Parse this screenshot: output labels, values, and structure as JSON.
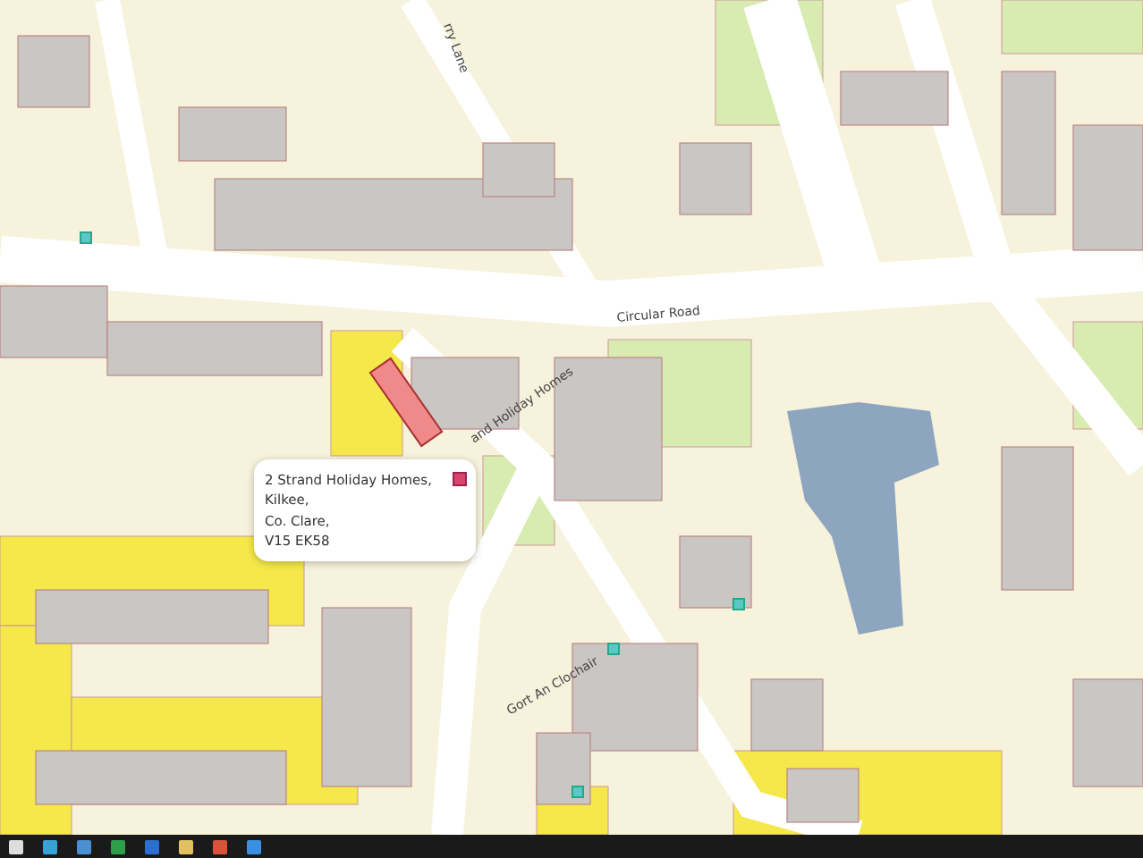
{
  "map": {
    "street_labels": [
      {
        "text": "rry Lane"
      },
      {
        "text": "Circular Road"
      },
      {
        "text": "and Holiday Homes"
      },
      {
        "text": "Gort An Clochair"
      }
    ]
  },
  "popup": {
    "lines": [
      "2 Strand Holiday Homes,",
      "Kilkee,",
      "Co. Clare,",
      "V15 EK58"
    ]
  }
}
